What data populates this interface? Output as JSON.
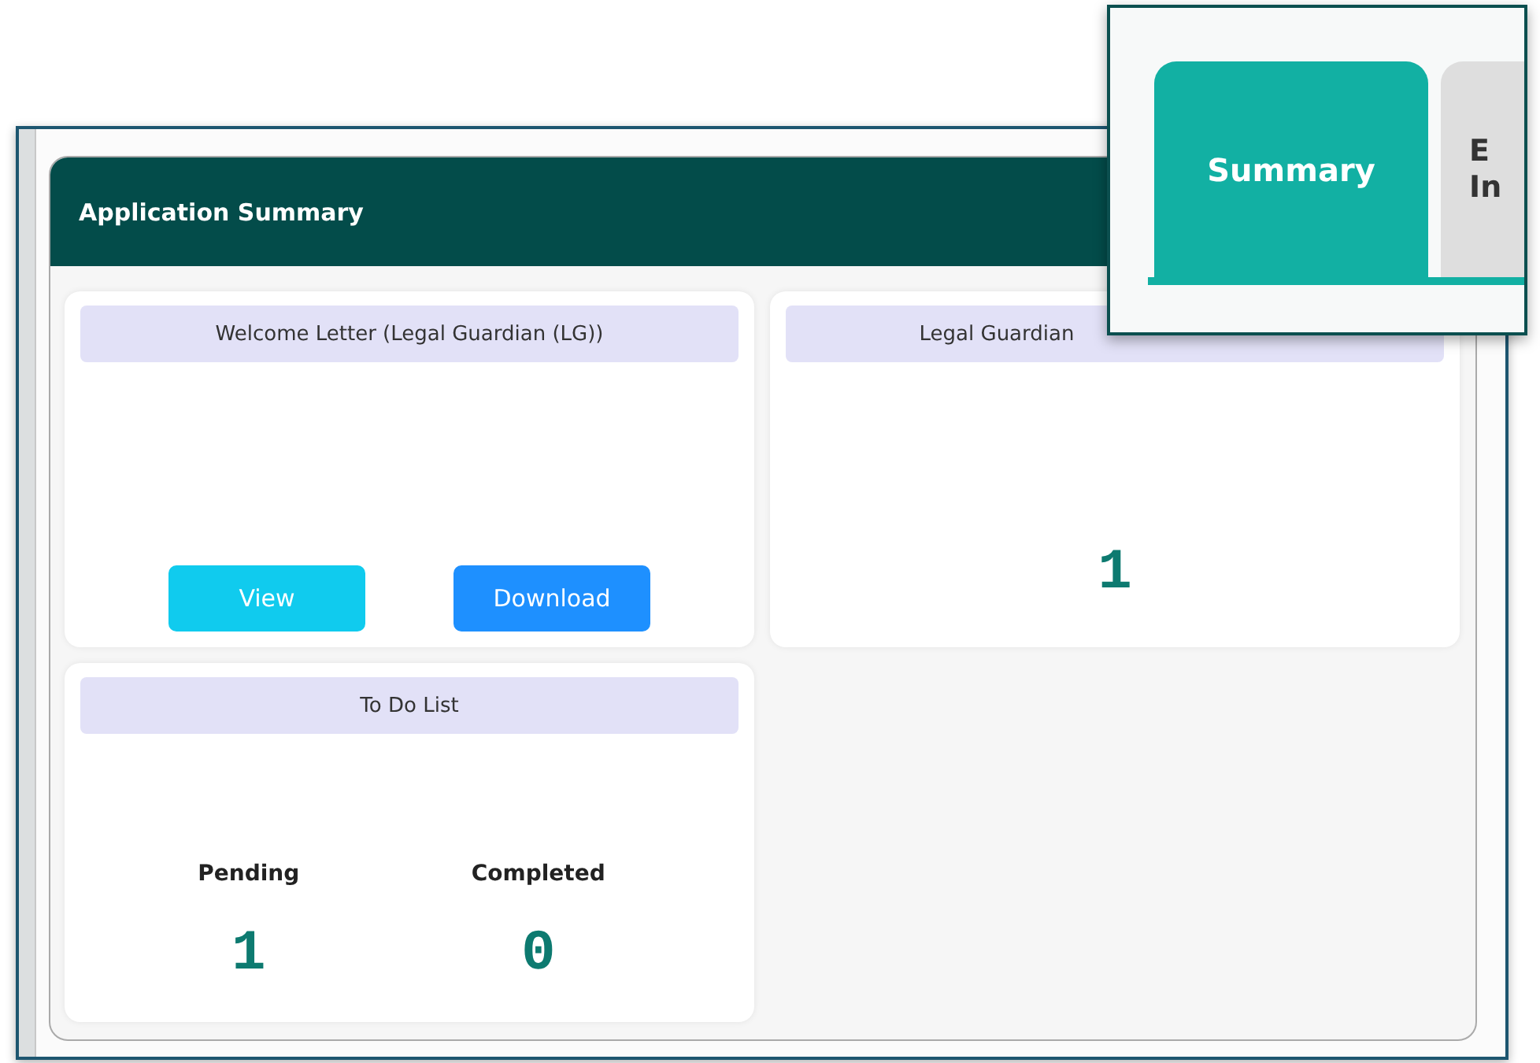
{
  "panel": {
    "title": "Application Summary"
  },
  "cards": [
    {
      "kind": "letter",
      "title": "Welcome Letter (Legal Guardian (LG))",
      "buttons": [
        {
          "label": "View",
          "kind": "view"
        },
        {
          "label": "Download",
          "kind": "download"
        }
      ]
    },
    {
      "kind": "count",
      "title": "Legal Guardian",
      "value": "1"
    },
    {
      "kind": "stats",
      "title": "To Do List",
      "stats": [
        {
          "label": "Pending",
          "value": "1"
        },
        {
          "label": "Completed",
          "value": "0"
        }
      ]
    }
  ],
  "inset_tabs": [
    {
      "lines": [
        "Summary"
      ],
      "selected": true
    },
    {
      "lines": [
        "E",
        "In"
      ],
      "selected": false
    }
  ]
}
